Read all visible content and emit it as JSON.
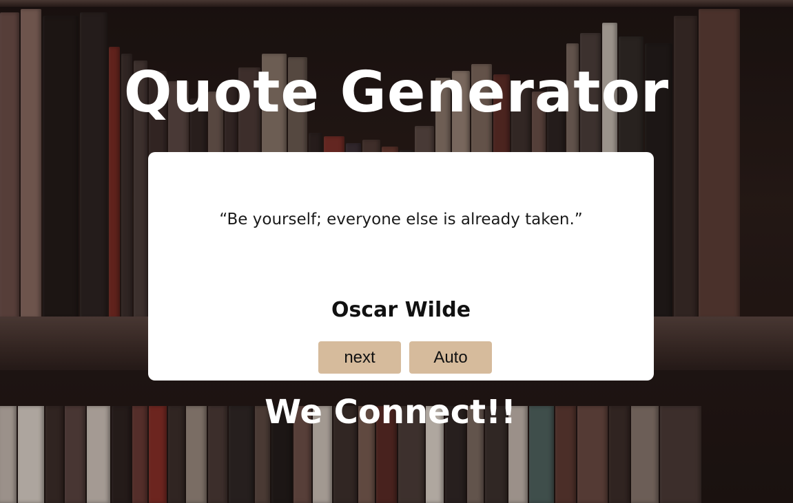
{
  "header": {
    "title": "Quote Generator"
  },
  "quote_card": {
    "quote_text": "“Be yourself; everyone else is already taken.”",
    "author": "Oscar Wilde",
    "next_label": "next",
    "auto_label": "Auto"
  },
  "footer": {
    "tagline": "We Connect!!"
  },
  "colors": {
    "card_background": "#ffffff",
    "button_background": "#d6bb9c",
    "title_text": "#ffffff",
    "shelf_background": "#2b1e1a"
  }
}
